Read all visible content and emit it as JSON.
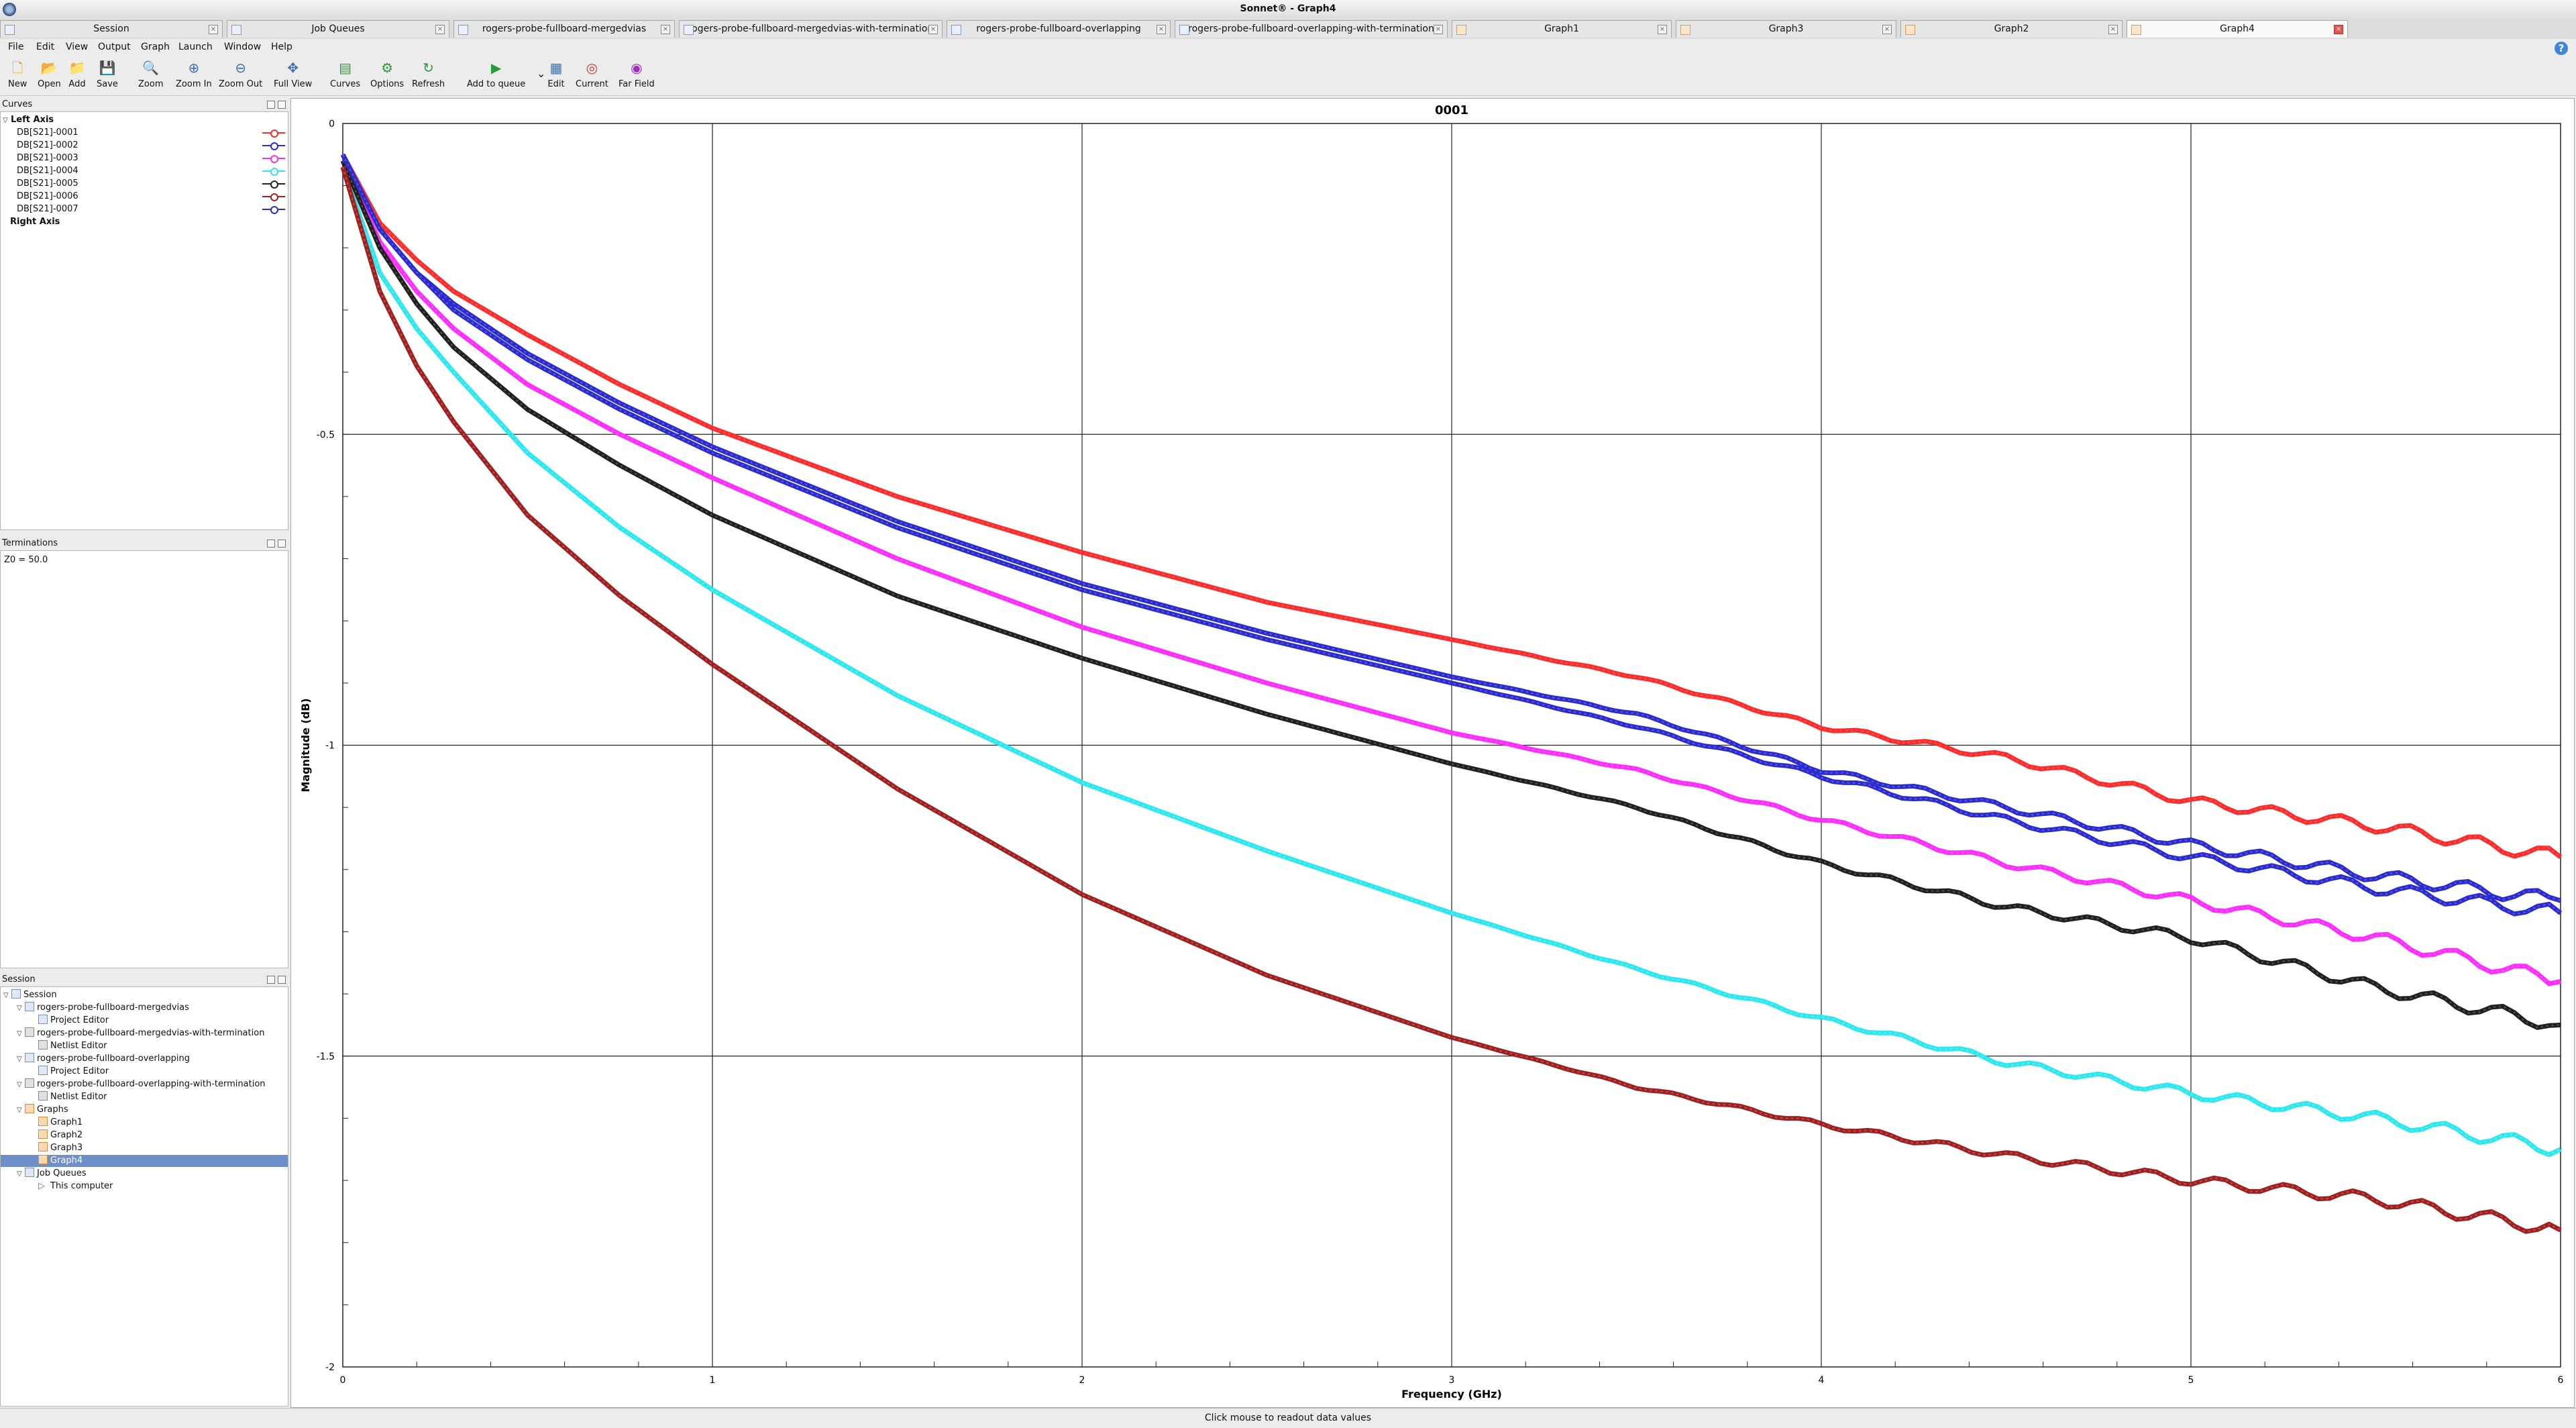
{
  "window": {
    "title": "Sonnet® - Graph4"
  },
  "tabs": [
    {
      "label": "Session",
      "icon": "session-icon"
    },
    {
      "label": "Job Queues",
      "icon": "job-queue-icon"
    },
    {
      "label": "rogers-probe-fullboard-mergedvias",
      "icon": "project-icon"
    },
    {
      "label": "rogers-probe-fullboard-mergedvias-with-termination",
      "icon": "netlist-icon"
    },
    {
      "label": "rogers-probe-fullboard-overlapping",
      "icon": "project-icon"
    },
    {
      "label": "rogers-probe-fullboard-overlapping-with-termination",
      "icon": "netlist-icon"
    },
    {
      "label": "Graph1",
      "icon": "graph-icon"
    },
    {
      "label": "Graph3",
      "icon": "graph-icon"
    },
    {
      "label": "Graph2",
      "icon": "graph-icon"
    },
    {
      "label": "Graph4",
      "icon": "graph-icon",
      "active": true
    }
  ],
  "menu": [
    "File",
    "Edit",
    "View",
    "Output",
    "Graph",
    "Launch",
    "Window",
    "Help"
  ],
  "toolbar": [
    {
      "label": "New",
      "icon": "new-file-icon",
      "glyph": "🗋",
      "color": "#d9a400"
    },
    {
      "label": "Open",
      "icon": "open-folder-icon",
      "glyph": "📂",
      "color": "#d9a400"
    },
    {
      "label": "Add",
      "icon": "add-folder-icon",
      "glyph": "📁",
      "color": "#d9a400"
    },
    {
      "label": "Save",
      "icon": "save-icon",
      "glyph": "💾",
      "color": "#d9a400"
    },
    {
      "label": "Zoom",
      "icon": "zoom-icon",
      "glyph": "🔍",
      "color": "#3a6fb5"
    },
    {
      "label": "Zoom In",
      "icon": "zoom-in-icon",
      "glyph": "⊕",
      "color": "#3a6fb5"
    },
    {
      "label": "Zoom Out",
      "icon": "zoom-out-icon",
      "glyph": "⊖",
      "color": "#3a6fb5"
    },
    {
      "label": "Full View",
      "icon": "full-view-icon",
      "glyph": "✥",
      "color": "#3a6fb5"
    },
    {
      "label": "Curves",
      "icon": "curves-icon",
      "glyph": "▤",
      "color": "#2a9a3a"
    },
    {
      "label": "Options",
      "icon": "options-icon",
      "glyph": "⚙",
      "color": "#2a9a3a"
    },
    {
      "label": "Refresh",
      "icon": "refresh-icon",
      "glyph": "↻",
      "color": "#2a9a3a"
    },
    {
      "label": "Add to queue",
      "icon": "add-to-queue-icon",
      "glyph": "▶",
      "color": "#2a9a3a"
    },
    {
      "label": "Edit",
      "icon": "edit-icon",
      "glyph": "▦",
      "color": "#3a6fb5"
    },
    {
      "label": "Current",
      "icon": "current-icon",
      "glyph": "◎",
      "color": "#d9342b"
    },
    {
      "label": "Far Field",
      "icon": "far-field-icon",
      "glyph": "◉",
      "color": "#a02cc0"
    }
  ],
  "panels": {
    "curves": {
      "title": "Curves",
      "left_axis": "Left Axis",
      "right_axis": "Right Axis",
      "items": [
        {
          "label": "DB[S21]-0001",
          "color": "#ff2b2b"
        },
        {
          "label": "DB[S21]-0002",
          "color": "#2b2bd0"
        },
        {
          "label": "DB[S21]-0003",
          "color": "#ff2bff"
        },
        {
          "label": "DB[S21]-0004",
          "color": "#2be8ee"
        },
        {
          "label": "DB[S21]-0005",
          "color": "#202020"
        },
        {
          "label": "DB[S21]-0006",
          "color": "#a02020"
        },
        {
          "label": "DB[S21]-0007",
          "color": "#2b2bd0"
        }
      ]
    },
    "terminations": {
      "title": "Terminations",
      "value": "Z0 = 50.0"
    },
    "session": {
      "title": "Session",
      "tree": [
        {
          "label": "Session",
          "depth": 0,
          "icon": "session-icon",
          "expand": true
        },
        {
          "label": "rogers-probe-fullboard-mergedvias",
          "depth": 1,
          "icon": "project-icon",
          "expand": true
        },
        {
          "label": "Project Editor",
          "depth": 2,
          "icon": "editor-icon"
        },
        {
          "label": "rogers-probe-fullboard-mergedvias-with-termination",
          "depth": 1,
          "icon": "netlist-icon",
          "expand": true
        },
        {
          "label": "Netlist Editor",
          "depth": 2,
          "icon": "netlist-editor-icon"
        },
        {
          "label": "rogers-probe-fullboard-overlapping",
          "depth": 1,
          "icon": "project-icon",
          "expand": true
        },
        {
          "label": "Project Editor",
          "depth": 2,
          "icon": "editor-icon"
        },
        {
          "label": "rogers-probe-fullboard-overlapping-with-termination",
          "depth": 1,
          "icon": "netlist-icon",
          "expand": true
        },
        {
          "label": "Netlist Editor",
          "depth": 2,
          "icon": "netlist-editor-icon"
        },
        {
          "label": "Graphs",
          "depth": 1,
          "icon": "graphs-folder-icon",
          "expand": true
        },
        {
          "label": "Graph1",
          "depth": 2,
          "icon": "graph-icon"
        },
        {
          "label": "Graph2",
          "depth": 2,
          "icon": "graph-icon"
        },
        {
          "label": "Graph3",
          "depth": 2,
          "icon": "graph-icon"
        },
        {
          "label": "Graph4",
          "depth": 2,
          "icon": "graph-icon",
          "selected": true
        },
        {
          "label": "Job Queues",
          "depth": 1,
          "icon": "job-queue-icon",
          "expand": true
        },
        {
          "label": "This computer",
          "depth": 2,
          "icon": "run-icon"
        }
      ]
    }
  },
  "status": {
    "text": "Click mouse to readout data values"
  },
  "chart_data": {
    "type": "line",
    "title": "0001",
    "xlabel": "Frequency (GHz)",
    "ylabel": "Magnitude (dB)",
    "xlim": [
      0,
      6
    ],
    "ylim": [
      -2,
      0
    ],
    "xticks": [
      "0",
      "1",
      "2",
      "3",
      "4",
      "5",
      "6"
    ],
    "yticks": [
      "0",
      "-0.5",
      "-1",
      "-1.5",
      "-2"
    ],
    "grid": true,
    "x": [
      0,
      0.1,
      0.2,
      0.3,
      0.5,
      0.75,
      1,
      1.5,
      2,
      2.5,
      3,
      3.5,
      4,
      4.5,
      5,
      5.5,
      6
    ],
    "series": [
      {
        "name": "DB[S21]-0001",
        "color": "#ff2b2b",
        "values": [
          -0.05,
          -0.16,
          -0.22,
          -0.27,
          -0.34,
          -0.42,
          -0.49,
          -0.6,
          -0.69,
          -0.77,
          -0.83,
          -0.89,
          -0.97,
          -1.02,
          -1.09,
          -1.13,
          -1.18
        ]
      },
      {
        "name": "DB[S21]-0002",
        "color": "#2b2bd0",
        "values": [
          -0.05,
          -0.17,
          -0.24,
          -0.29,
          -0.37,
          -0.45,
          -0.52,
          -0.64,
          -0.74,
          -0.82,
          -0.89,
          -0.95,
          -1.04,
          -1.1,
          -1.16,
          -1.21,
          -1.25
        ]
      },
      {
        "name": "DB[S21]-0003",
        "color": "#ff2bff",
        "values": [
          -0.06,
          -0.19,
          -0.27,
          -0.33,
          -0.42,
          -0.5,
          -0.57,
          -0.7,
          -0.81,
          -0.9,
          -0.98,
          -1.04,
          -1.12,
          -1.19,
          -1.25,
          -1.31,
          -1.38
        ]
      },
      {
        "name": "DB[S21]-0004",
        "color": "#2be8ee",
        "values": [
          -0.07,
          -0.24,
          -0.33,
          -0.4,
          -0.53,
          -0.65,
          -0.75,
          -0.92,
          -1.06,
          -1.17,
          -1.27,
          -1.36,
          -1.44,
          -1.51,
          -1.56,
          -1.6,
          -1.65
        ]
      },
      {
        "name": "DB[S21]-0005",
        "color": "#202020",
        "values": [
          -0.06,
          -0.2,
          -0.29,
          -0.36,
          -0.46,
          -0.55,
          -0.63,
          -0.76,
          -0.86,
          -0.95,
          -1.03,
          -1.1,
          -1.19,
          -1.26,
          -1.31,
          -1.39,
          -1.45
        ]
      },
      {
        "name": "DB[S21]-0006",
        "color": "#a02020",
        "values": [
          -0.07,
          -0.27,
          -0.39,
          -0.48,
          -0.63,
          -0.76,
          -0.87,
          -1.07,
          -1.24,
          -1.37,
          -1.47,
          -1.55,
          -1.61,
          -1.66,
          -1.7,
          -1.73,
          -1.78
        ]
      },
      {
        "name": "DB[S21]-0007",
        "color": "#2b2bd0",
        "values": [
          -0.05,
          -0.17,
          -0.24,
          -0.3,
          -0.38,
          -0.46,
          -0.53,
          -0.65,
          -0.75,
          -0.83,
          -0.9,
          -0.97,
          -1.05,
          -1.12,
          -1.18,
          -1.23,
          -1.27
        ]
      }
    ]
  }
}
